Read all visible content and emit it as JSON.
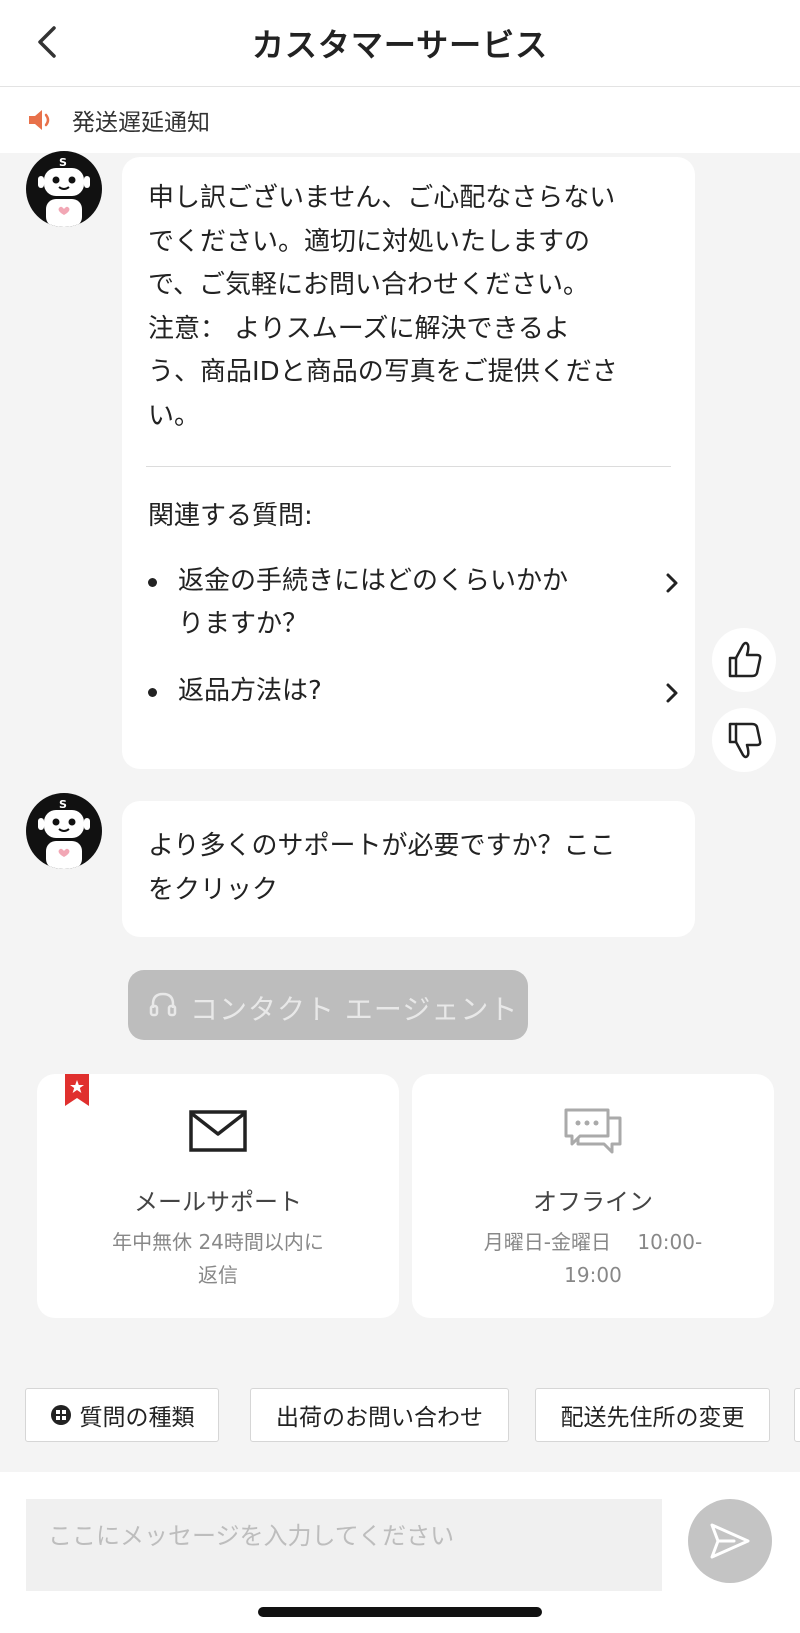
{
  "header": {
    "title": "カスタマーサービス",
    "back_icon": "chevron-left-icon"
  },
  "notice": {
    "icon": "speaker-icon",
    "text": "発送遅延通知",
    "accent": "#e8714a"
  },
  "messages": [
    {
      "lines": [
        "申し訳ございません、ご心配なさらない",
        "でください。適切に対処いたしますの",
        "で、ご気軽にお問い合わせください。",
        "注意： よりスムーズに解決できるよ",
        "う、商品IDと商品の写真をご提供くださ",
        "い。"
      ],
      "related_title": "関連する質問:",
      "related": [
        {
          "lines": [
            "返金の手続きにはどのくらいかか",
            "りますか？"
          ]
        },
        {
          "lines": [
            "返品方法は?"
          ]
        }
      ]
    },
    {
      "lines": [
        "より多くのサポートが必要ですか？ここ",
        "をクリック"
      ]
    }
  ],
  "feedback": {
    "like_icon": "thumbs-up-icon",
    "dislike_icon": "thumbs-down-icon"
  },
  "contact_agent": {
    "label": "コンタクト エージェント",
    "icon": "headphones-icon"
  },
  "support_cards": [
    {
      "icon": "mail-icon",
      "title": "メールサポート",
      "desc_lines": [
        "年中無休 24時間以内に",
        "返信"
      ],
      "badge_icon": "star-bookmark-icon"
    },
    {
      "icon": "chat-bubbles-icon",
      "title": "オフライン",
      "desc_lines": [
        "月曜日-金曜日　 10:00-",
        "19:00"
      ]
    }
  ],
  "chips": [
    "質問の種類",
    "出荷のお問い合わせ",
    "配送先住所の変更"
  ],
  "input": {
    "placeholder": "ここにメッセージを入力してください",
    "send_icon": "send-icon"
  },
  "colors": {
    "background": "#f4f4f4",
    "button_disabled": "#bdbdbd",
    "send_button": "#c4c4c4"
  }
}
